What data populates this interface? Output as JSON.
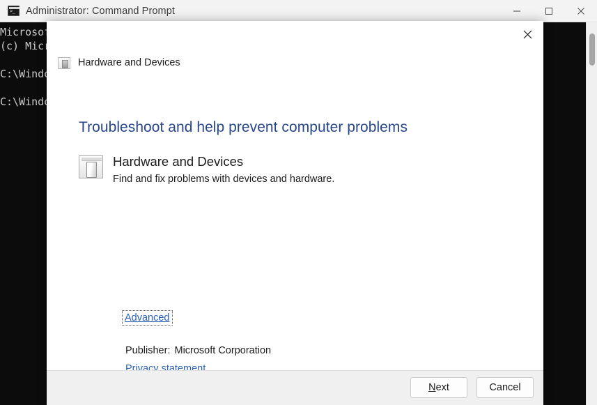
{
  "window": {
    "title": "Administrator: Command Prompt",
    "icon": "command-prompt-icon",
    "controls": {
      "minimize": "minimize-icon",
      "maximize": "maximize-icon",
      "close": "close-icon"
    },
    "console_text": "Microsof\n(c) Micr\n\nC:\\Windo\n\nC:\\Windo"
  },
  "dialog": {
    "close_icon": "close-icon",
    "header": {
      "icon": "hardware-devices-icon",
      "label": "Hardware and Devices"
    },
    "heading": "Troubleshoot and help prevent computer problems",
    "item": {
      "icon": "hardware-devices-icon",
      "title": "Hardware and Devices",
      "description": "Find and fix problems with devices and hardware."
    },
    "advanced_link": "Advanced",
    "publisher_label": "Publisher:",
    "publisher_value": "Microsoft Corporation",
    "privacy_link": "Privacy statement",
    "buttons": {
      "next_accel": "N",
      "next_rest": "ext",
      "cancel": "Cancel"
    }
  },
  "colors": {
    "heading_blue": "#27468c",
    "link_blue": "#2a62b6",
    "console_bg": "#0c0c0c",
    "console_fg": "#cccccc",
    "titlebar_bg": "#f3f3f3",
    "footer_bg": "#f0f0f0"
  }
}
